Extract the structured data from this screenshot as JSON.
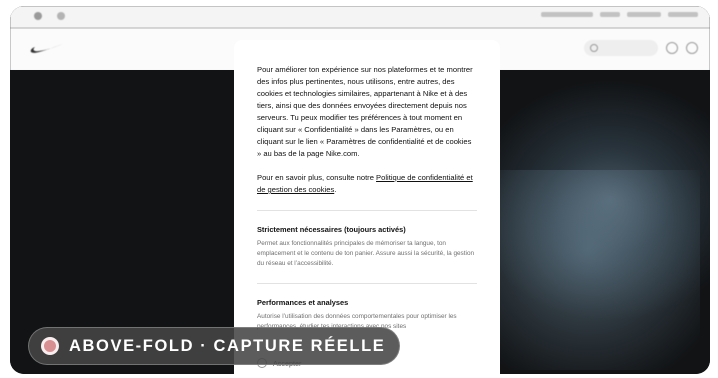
{
  "header": {
    "logo_icon": "nike-swoosh-icon",
    "icons": [
      "search-icon",
      "heart-icon",
      "bag-icon"
    ]
  },
  "cookie_modal": {
    "intro": "Pour améliorer ton expérience sur nos plateformes et te montrer des infos plus pertinentes, nous utilisons, entre autres, des cookies et technologies similaires, appartenant à Nike et à des tiers, ainsi que des données envoyées directement depuis nos serveurs. Tu peux modifier tes préférences à tout moment en cliquant sur « Confidentialité » dans les Paramètres, ou en cliquant sur le lien « Paramètres de confidentialité et de cookies » au bas de la page Nike.com.",
    "more_prefix": "Pour en savoir plus, consulte notre ",
    "more_link": "Politique de confidentialité et de gestion des cookies",
    "more_suffix": ".",
    "sections": [
      {
        "title": "Strictement nécessaires (toujours activés)",
        "description": "Permet aux fonctionnalités principales de mémoriser ta langue, ton emplacement et le contenu de ton panier. Assure aussi la sécurité, la gestion du réseau et l’accessibilité."
      },
      {
        "title": "Performances et analyses",
        "description": "Autorise l’utilisation des données comportementales pour optimiser les performances, étudier tes interactions avec nos sites"
      }
    ],
    "accept_label": "Accepter"
  },
  "badge": {
    "text": "ABOVE-FOLD · CAPTURE RÉELLE",
    "dot_color": "#d88f92"
  },
  "colors": {
    "hero_background": "#111315",
    "modal_background": "#ffffff",
    "badge_background": "#464646"
  }
}
